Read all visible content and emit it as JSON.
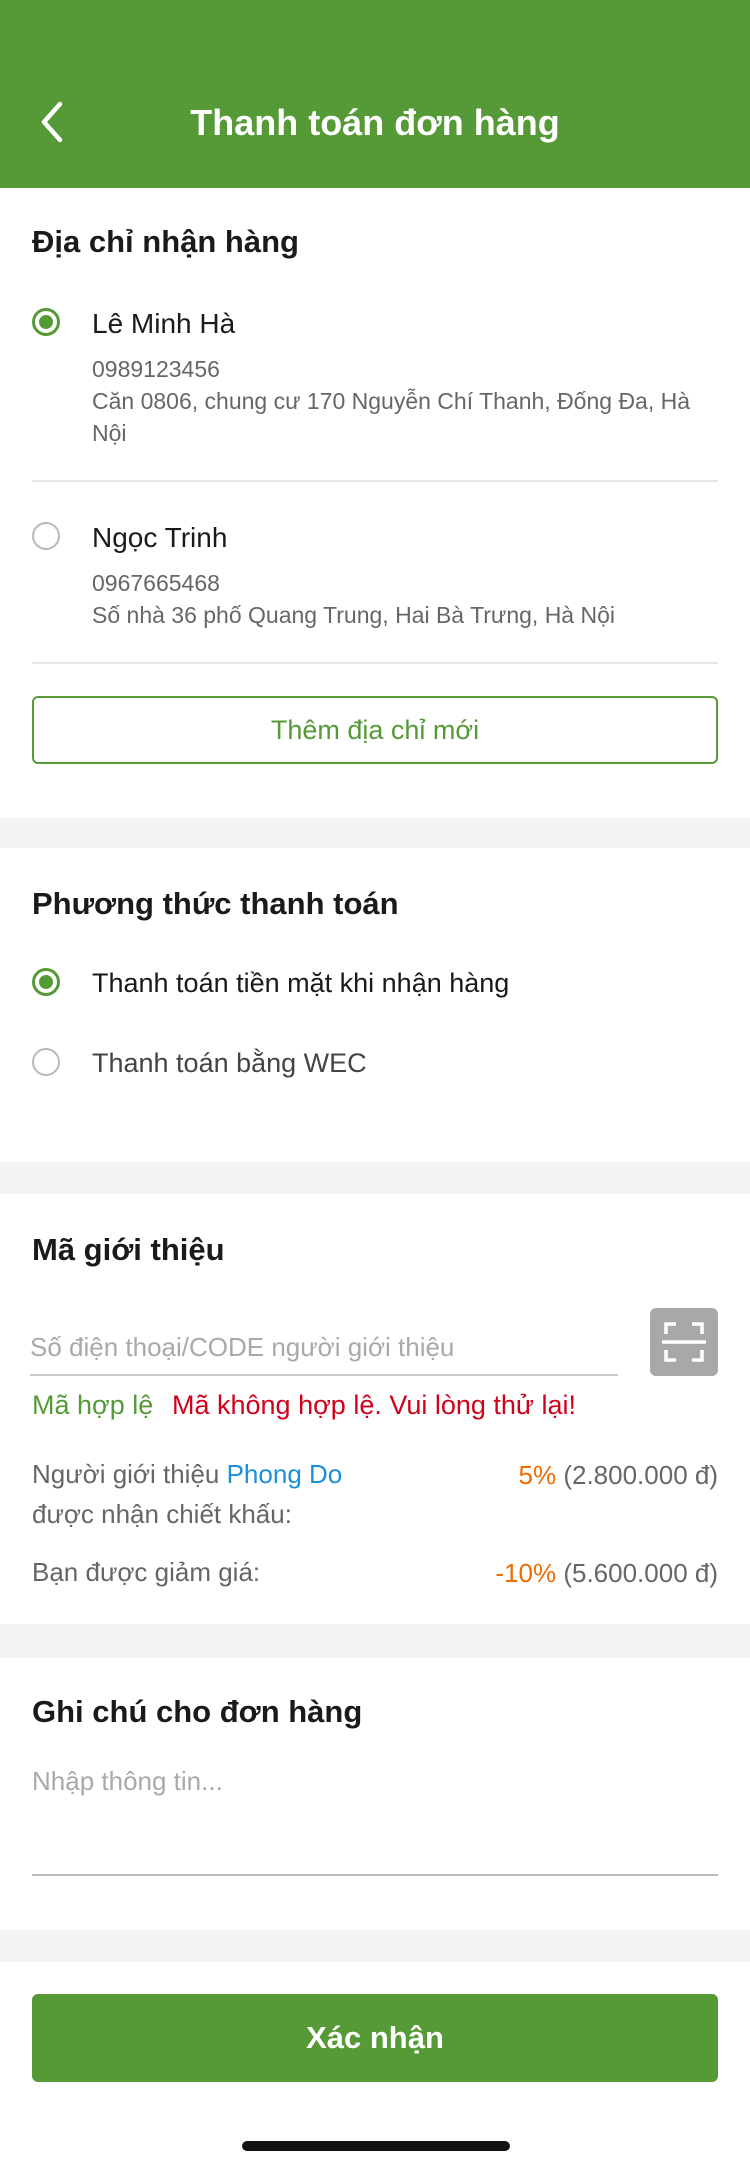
{
  "header": {
    "title": "Thanh toán đơn hàng"
  },
  "address": {
    "title": "Địa chỉ nhận hàng",
    "items": [
      {
        "name": "Lê Minh Hà",
        "phone": "0989123456",
        "line1": "Căn 0806, chung cư 170 Nguyễn Chí Thanh, Đống Đa, Hà",
        "line2": "Nội",
        "selected": true
      },
      {
        "name": "Ngọc Trinh",
        "phone": "0967665468",
        "line1": "Số nhà 36 phố Quang Trung, Hai Bà Trưng, Hà Nội",
        "line2": "",
        "selected": false
      }
    ],
    "add_label": "Thêm địa chỉ mới"
  },
  "payment": {
    "title": "Phương thức thanh toán",
    "options": [
      {
        "label": "Thanh toán tiền mặt khi nhận hàng",
        "selected": true
      },
      {
        "label": "Thanh toán bằng WEC",
        "selected": false
      }
    ]
  },
  "referral": {
    "title": "Mã giới thiệu",
    "placeholder": "Số điện thoại/CODE người giới thiệu",
    "value": "",
    "valid_text": "Mã hợp lệ",
    "invalid_text": "Mã không hợp lệ. Vui lòng thử lại!",
    "referrer_label_1": "Người giới thiệu",
    "referrer_name": "Phong Do",
    "referrer_label_2": "được nhận chiết khấu:",
    "referrer_pct": "5%",
    "referrer_amount": "(2.800.000 đ)",
    "discount_label": "Bạn được giảm giá:",
    "discount_pct": "-10%",
    "discount_amount": "(5.600.000 đ)"
  },
  "note": {
    "title": "Ghi chú cho đơn hàng",
    "placeholder": "Nhập thông tin..."
  },
  "confirm_label": "Xác nhận",
  "colors": {
    "brand_green": "#559a36",
    "error_red": "#d0021b",
    "accent_orange": "#ef6c00",
    "link_blue": "#1a90d9"
  },
  "icons": {
    "back": "chevron-left-icon",
    "scan": "qr-scan-icon"
  }
}
